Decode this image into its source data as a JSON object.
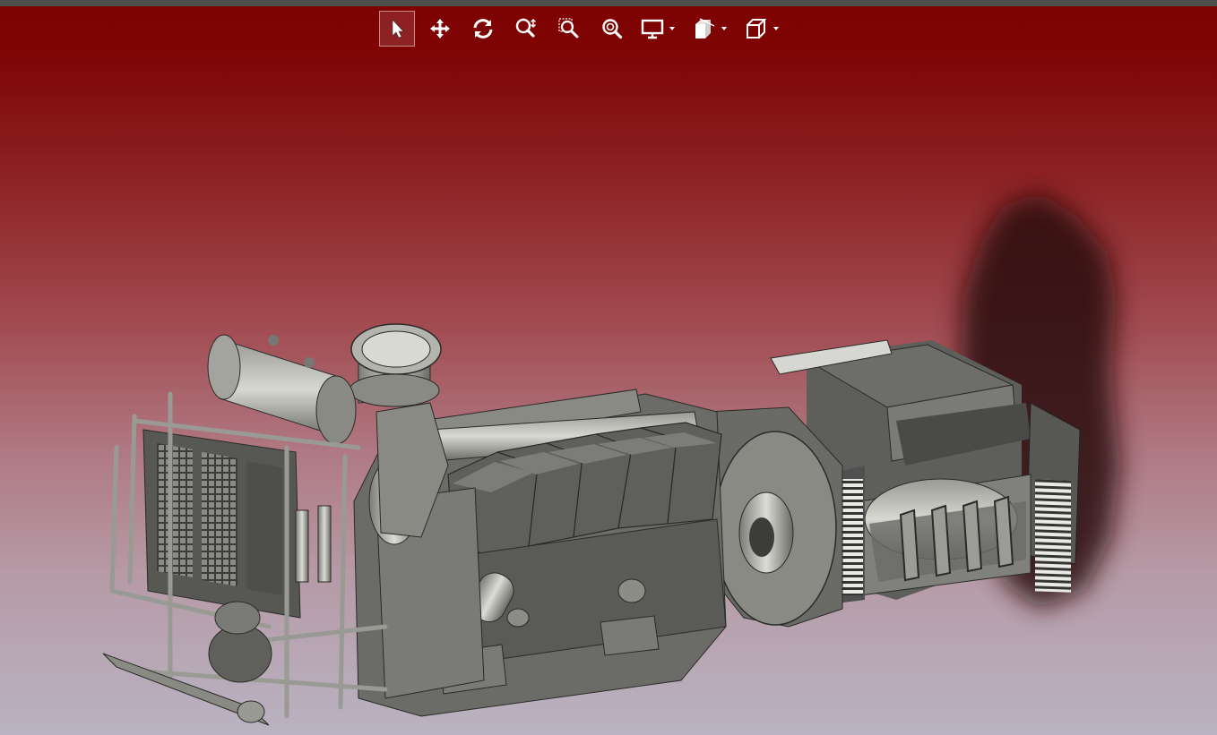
{
  "viewer": {
    "background_top": "#7e0000",
    "background_bottom": "#b9b3c2",
    "model_color": "#6f6f6b",
    "model_shadow_color": "#2a0f10"
  },
  "toolbar": {
    "tools": [
      {
        "id": "select",
        "icon": "cursor-arrow-icon",
        "active": true
      },
      {
        "id": "pan",
        "icon": "move-arrows-icon",
        "active": false
      },
      {
        "id": "rotate",
        "icon": "rotate-icon",
        "active": false
      },
      {
        "id": "zoom",
        "icon": "zoom-in-out-icon",
        "active": false
      },
      {
        "id": "zoom-window",
        "icon": "zoom-window-icon",
        "active": false
      },
      {
        "id": "zoom-fit",
        "icon": "zoom-fit-icon",
        "active": false
      },
      {
        "id": "display-mode",
        "icon": "monitor-icon",
        "has_dropdown": true
      },
      {
        "id": "section",
        "icon": "section-plane-icon",
        "has_dropdown": true
      },
      {
        "id": "view-orientation",
        "icon": "cube-icon",
        "has_dropdown": true
      }
    ]
  }
}
